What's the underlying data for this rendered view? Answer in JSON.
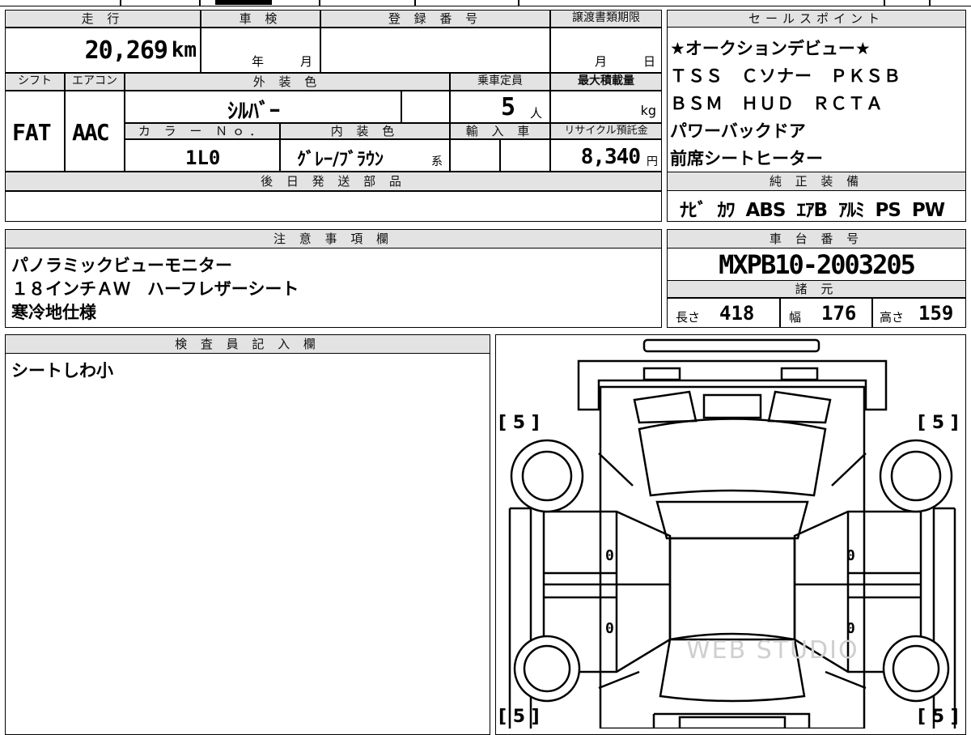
{
  "mileage": {
    "header": "走 行",
    "value": "20,269",
    "unit": "km"
  },
  "shaken": {
    "header": "車 検",
    "year": "年",
    "month": "月"
  },
  "registration": {
    "header": "登 録 番 号",
    "value": ""
  },
  "transfer_deadline": {
    "header": "譲渡書類期限",
    "month": "月",
    "day": "日"
  },
  "shift": {
    "header": "シフト",
    "value": "FAT"
  },
  "aircon": {
    "header": "エアコン",
    "value": "AAC"
  },
  "exterior_color": {
    "header": "外 装 色",
    "value": "ｼﾙﾊﾞｰ"
  },
  "capacity": {
    "header": "乗車定員",
    "value": "5",
    "unit": "人"
  },
  "max_load": {
    "header": "最大積載量",
    "unit": "kg"
  },
  "color_no": {
    "header": "カ ラ ー Ｎｏ．",
    "value": "1L0"
  },
  "interior_color": {
    "header": "内 装 色",
    "value": "ｸﾞﾚｰ/ﾌﾞﾗｳﾝ",
    "suffix": "系"
  },
  "import": {
    "header": "輸 入 車"
  },
  "recycle": {
    "header": "リサイクル預託金",
    "value": "8,340",
    "unit": "円"
  },
  "later_parts": {
    "header": "後 日 発 送 部 品",
    "value": ""
  },
  "sales_points": {
    "header": "セールスポイント",
    "lines": [
      "★オークションデビュー★",
      "ＴＳＳ　Ｃソナー　ＰＫＳＢ",
      "ＢＳＭ　ＨＵＤ　ＲＣＴＡ",
      "パワーバックドア",
      "前席シートヒーター"
    ]
  },
  "standard_equipment": {
    "header": "純 正 装 備",
    "value": "ﾅﾋﾞ  ｶﾜ  ABS  ｴｱB  ｱﾙﾐ  PS  PW"
  },
  "notes": {
    "header": "注 意 事 項 欄",
    "lines": [
      "パノラミックビューモニター",
      "１８インチＡＷ　ハーフレザーシート",
      "寒冷地仕様"
    ]
  },
  "chassis": {
    "header": "車 台 番 号",
    "value": "MXPB10-2003205"
  },
  "specs": {
    "header": "諸 元",
    "length_label": "長さ",
    "length": "418",
    "width_label": "幅",
    "width": "176",
    "height_label": "高さ",
    "height": "159"
  },
  "inspector": {
    "header": "検 査 員 記 入 欄",
    "comment": "シートしわ小"
  },
  "diagram": {
    "tire_fl": "[ 5 ]",
    "tire_fr": "[ 5 ]",
    "tire_rl": "[ 5 ]",
    "tire_rr": "[ 5 ]",
    "door_fl": "0",
    "door_rl": "0",
    "door_fr": "0",
    "door_rr": "0",
    "watermark": "WEB STUDIO"
  }
}
